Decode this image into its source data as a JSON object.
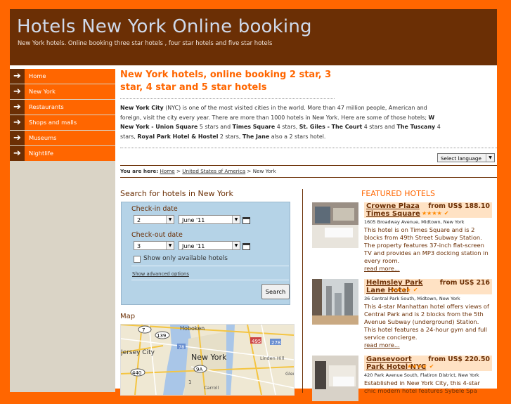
{
  "header": {
    "title": "Hotels New York Online booking",
    "tagline": "New York hotels. Online booking three star hotels , four star hotels and five star hotels"
  },
  "menu": [
    {
      "label": "Home"
    },
    {
      "label": "New York"
    },
    {
      "label": "Restaurants"
    },
    {
      "label": "Shops and malls"
    },
    {
      "label": "Museums"
    },
    {
      "label": "Nightlife"
    }
  ],
  "main": {
    "heading": "New York hotels, online booking 2 star, 3 star, 4 star and 5 star hotels",
    "intro": {
      "t1": "New York City",
      "t2": " (NYC) is one of the most visited cities in the world. More than 47 million people, American and foreign, visit the city every year. There are more than 1000 hotels in New York. Here are some of those hotels; ",
      "t3": "W New York - Union Square",
      "t4": " 5 stars and ",
      "t5": "Times Square",
      "t6": " 4 stars, ",
      "t7": "St. Giles - The Court",
      "t8": " 4 stars and ",
      "t9": "The Tuscany",
      "t10": " 4 stars, ",
      "t11": "Royal Park Hotel & Hostel",
      "t12": " 2 stars, ",
      "t13": "The Jane",
      "t14": " also a 2 stars hotel."
    },
    "language_select": "Select language",
    "breadcrumb": {
      "prefix": "You are here:",
      "home": "Home",
      "sep1": " > ",
      "country": "United States of America",
      "sep2": " > ",
      "current": "New York"
    }
  },
  "search": {
    "heading": "Search for hotels in New York",
    "checkin_label": "Check-in date",
    "checkin_day": "2",
    "checkin_month": "June '11",
    "checkout_label": "Check-out date",
    "checkout_day": "3",
    "checkout_month": "June '11",
    "available_only": "Show only available hotels",
    "advanced": "Show advanced options",
    "button": "Search"
  },
  "map": {
    "heading": "Map",
    "labels": [
      "Hoboken",
      "Jersey City",
      "New York",
      "Linden Hill",
      "Glen",
      "Carroll",
      "7",
      "139",
      "78",
      "495",
      "278",
      "440",
      "9A",
      "1"
    ]
  },
  "featured": {
    "heading": "FEATURED HOTELS",
    "hotels": [
      {
        "name": "Crowne Plaza Times Square",
        "price": "from US$ 188.10",
        "stars": "★★★★",
        "address": "1605 Broadway Avenue, Midtown, New York",
        "description": "This hotel is on Times Square and is 2 blocks from 49th Street Subway Station. The property features 37-inch flat-screen TV and provides an MP3 docking station in every room.",
        "more": "read more..."
      },
      {
        "name": "Helmsley Park Lane Hotel",
        "price": "from US$ 216",
        "stars": "★★★★",
        "address": "36 Central Park South, Midtown, New York",
        "description": "This 4-star Manhattan hotel offers views of Central Park and is 2 blocks from the 5th Avenue Subway (underground) Station. This hotel features a 24-hour gym and full service concierge.",
        "more": "read more..."
      },
      {
        "name": "Gansevoort Park Hotel NYC",
        "price": "from US$ 220.50",
        "stars": "★★★★",
        "address": "420 Park Avenue South, Flatiron District, New York",
        "description": "Established in New York City, this 4-star chic modern hotel features Sybele Spa",
        "more": ""
      }
    ]
  },
  "colors": {
    "accent": "#ff6600",
    "brown": "#6b2f05",
    "search_bg": "#b5d3e7"
  }
}
